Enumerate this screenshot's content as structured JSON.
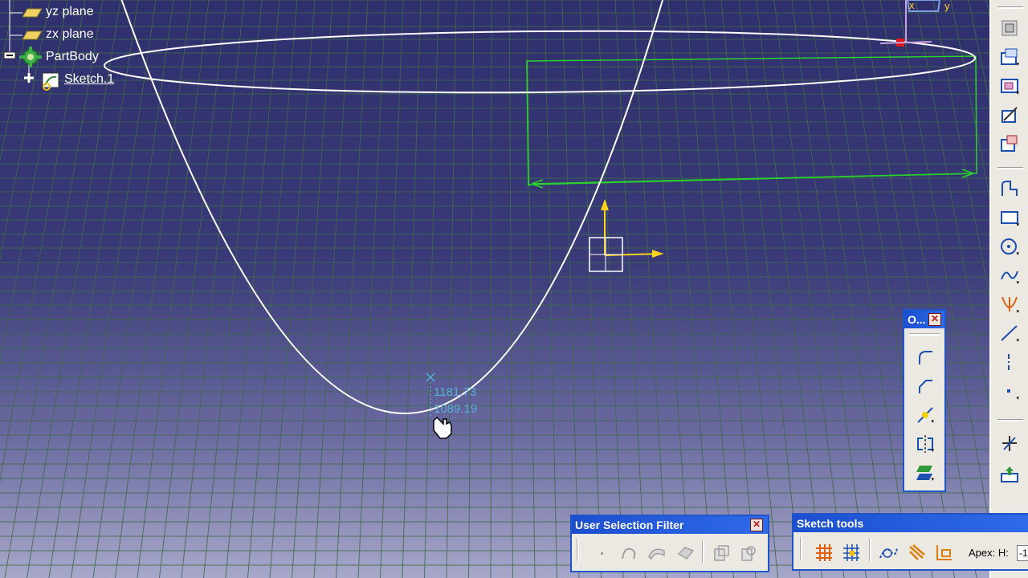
{
  "tree": {
    "items": [
      {
        "label": "yz plane",
        "icon": "plane-icon"
      },
      {
        "label": "zx plane",
        "icon": "plane-icon"
      },
      {
        "label": "PartBody",
        "icon": "partbody-gear-icon"
      },
      {
        "label": "Sketch.1",
        "icon": "sketch-icon"
      }
    ]
  },
  "viewport": {
    "cursor_coords": {
      "h": "1181.73",
      "v": "1089.19"
    },
    "axis_labels": {
      "x": "x",
      "y": "y"
    },
    "colors": {
      "curve": "#ffffff",
      "grid": "#3d6a4a",
      "constraint": "#2bd12b",
      "axis": "#ffd21c",
      "coord": "#5aaee0"
    }
  },
  "operations_toolbar": {
    "title": "O...",
    "icons": [
      "corner-icon",
      "chamfer-icon",
      "trim-icon",
      "mirror-icon",
      "project-3d-elements-icon"
    ]
  },
  "user_selection_filter": {
    "title": "User Selection Filter",
    "icons": [
      "point-filter-icon",
      "curve-filter-icon",
      "surface-filter-icon",
      "volume-filter-icon",
      "feature-element-filter-icon",
      "geometrical-element-filter-icon"
    ]
  },
  "sketch_tools": {
    "title": "Sketch tools",
    "icons": [
      "grid-icon",
      "snap-to-point-icon",
      "construction-element-icon",
      "geometrical-constraints-icon",
      "dimensional-constraints-icon"
    ],
    "apex_label": "Apex: H:",
    "apex_value": "-1"
  },
  "right_toolbar": {
    "icons": [
      "sketcher-options-icon",
      "cut-part-icon",
      "normal-view-icon",
      "sketch-analysis-icon",
      "output-feature-icon",
      "profile-icon",
      "rectangle-icon",
      "circle-icon",
      "spline-icon",
      "conic-icon",
      "line-icon",
      "axis-icon",
      "point-icon",
      "exit-sketcher-icon",
      "update-icon"
    ]
  }
}
